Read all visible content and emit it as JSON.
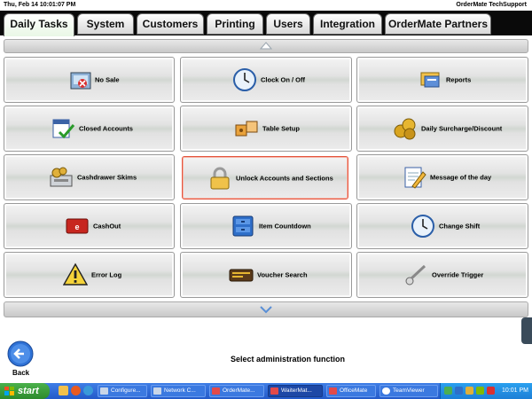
{
  "topbar": {
    "datetime": "Thu, Feb 14  10:01:07 PM",
    "user": "OrderMate TechSupport"
  },
  "tabs": [
    {
      "label": "Daily Tasks",
      "active": true
    },
    {
      "label": "System"
    },
    {
      "label": "Customers"
    },
    {
      "label": "Printing"
    },
    {
      "label": "Users"
    },
    {
      "label": "Integration"
    },
    {
      "label": "OrderMate Partners"
    }
  ],
  "functions": [
    {
      "label": "No Sale",
      "icon": "register-icon"
    },
    {
      "label": "Clock On / Off",
      "icon": "clock-icon"
    },
    {
      "label": "Reports",
      "icon": "reports-icon"
    },
    {
      "label": "Closed Accounts",
      "icon": "calendar-check-icon"
    },
    {
      "label": "Table Setup",
      "icon": "table-icon"
    },
    {
      "label": "Daily Surcharge/Discount",
      "icon": "coins-icon"
    },
    {
      "label": "Cashdrawer Skims",
      "icon": "cashdrawer-icon"
    },
    {
      "label": "Unlock Accounts and Sections",
      "icon": "padlock-icon",
      "selected": true
    },
    {
      "label": "Message of the day",
      "icon": "notepad-icon"
    },
    {
      "label": "CashOut",
      "icon": "eftpos-icon"
    },
    {
      "label": "Item Countdown",
      "icon": "cabinet-icon"
    },
    {
      "label": "Change Shift",
      "icon": "clock-icon"
    },
    {
      "label": "Error Log",
      "icon": "warning-icon"
    },
    {
      "label": "Voucher Search",
      "icon": "voucher-icon"
    },
    {
      "label": "Override Trigger",
      "icon": "trigger-icon"
    }
  ],
  "bottom": {
    "back_label": "Back",
    "status": "Select administration function"
  },
  "taskbar": {
    "start_label": "start",
    "items": [
      {
        "label": "Configure...",
        "active": false
      },
      {
        "label": "Network C...",
        "active": false
      },
      {
        "label": "OrderMate...",
        "active": false
      },
      {
        "label": "WaiterMat...",
        "active": true
      },
      {
        "label": "OfficeMate",
        "active": false
      },
      {
        "label": "TeamViewer",
        "active": false
      }
    ],
    "clock": "10:01 PM"
  },
  "colors": {
    "accent_selected": "#e4553e",
    "tab_bar": "#0a0a0a",
    "taskbar": "#245ac9"
  }
}
